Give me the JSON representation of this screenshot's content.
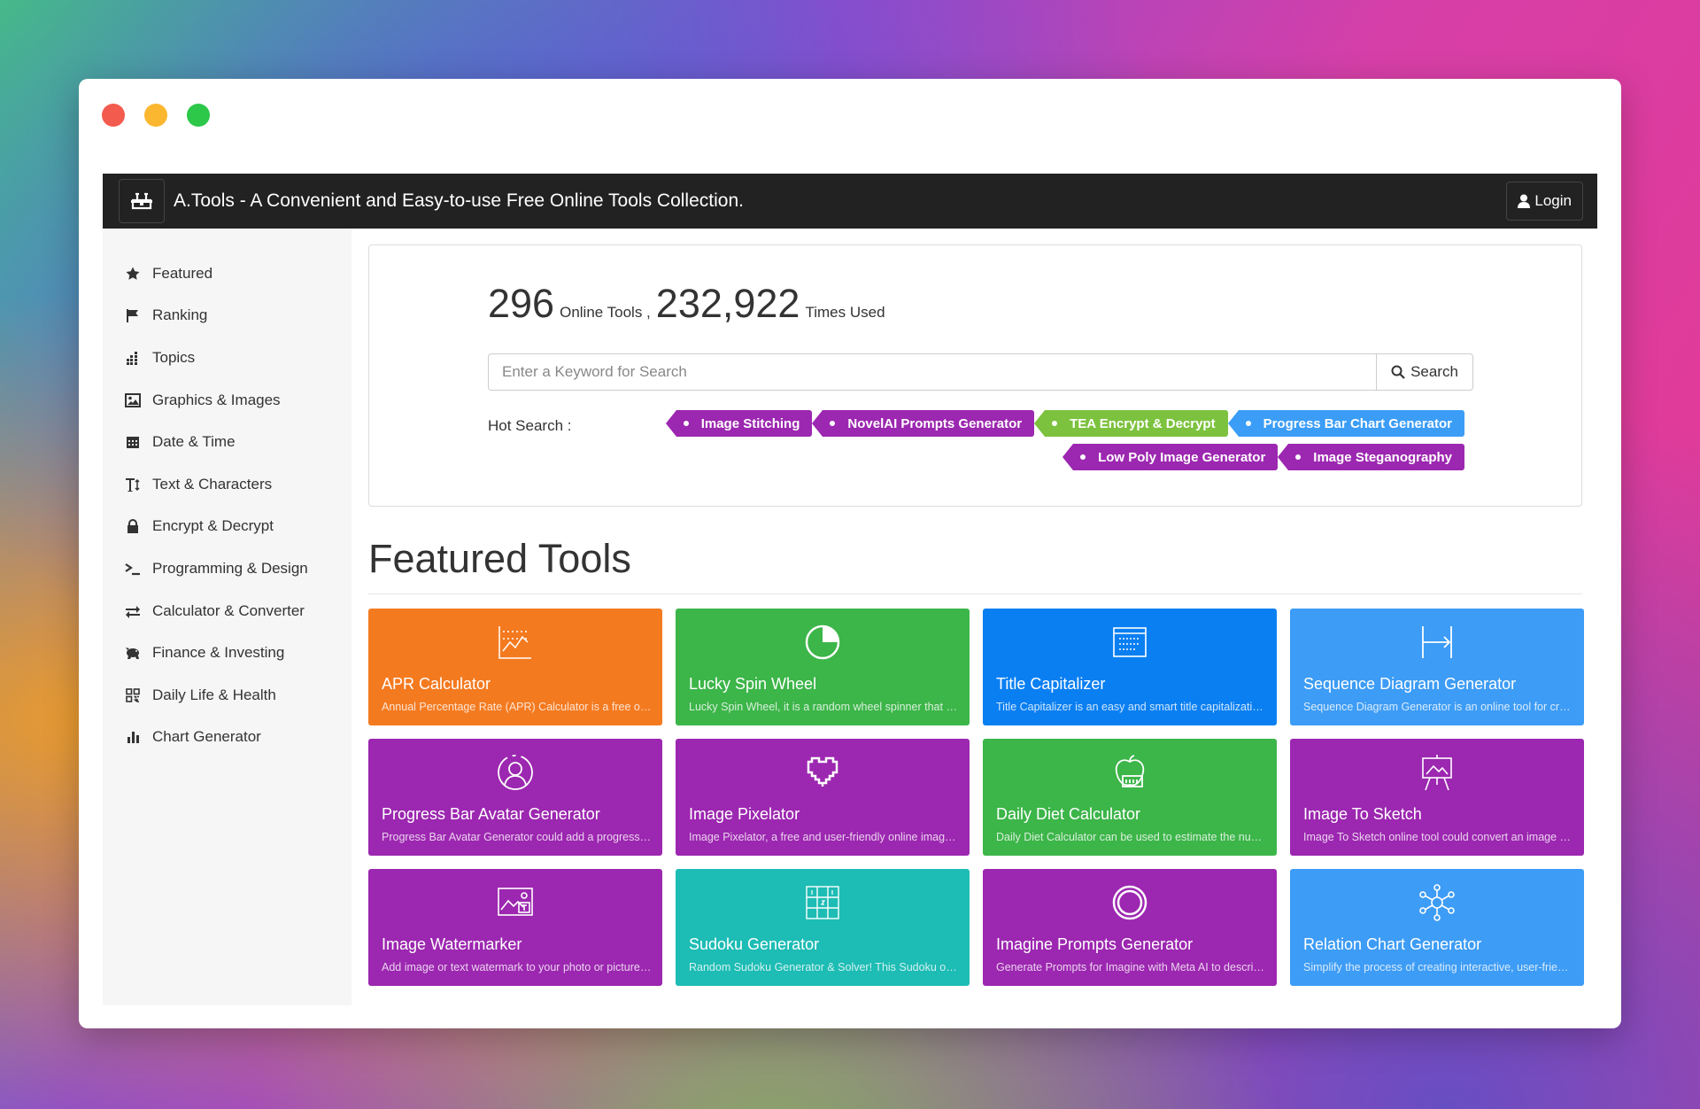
{
  "header": {
    "title": "A.Tools - A Convenient and Easy-to-use Free Online Tools Collection.",
    "login_label": "Login"
  },
  "sidebar": {
    "items": [
      {
        "label": "Featured",
        "icon": "star-icon"
      },
      {
        "label": "Ranking",
        "icon": "flag-icon"
      },
      {
        "label": "Topics",
        "icon": "dots-grid-icon"
      },
      {
        "label": "Graphics & Images",
        "icon": "image-icon"
      },
      {
        "label": "Date & Time",
        "icon": "calendar-icon"
      },
      {
        "label": "Text & Characters",
        "icon": "text-height-icon"
      },
      {
        "label": "Encrypt & Decrypt",
        "icon": "lock-icon"
      },
      {
        "label": "Programming & Design",
        "icon": "terminal-icon"
      },
      {
        "label": "Calculator & Converter",
        "icon": "swap-arrows-icon"
      },
      {
        "label": "Finance & Investing",
        "icon": "piggy-bank-icon"
      },
      {
        "label": "Daily Life & Health",
        "icon": "qr-code-icon"
      },
      {
        "label": "Chart Generator",
        "icon": "bar-chart-icon"
      }
    ]
  },
  "hero": {
    "tools_count": "296",
    "tools_label": "Online Tools ,",
    "uses_count": "232,922",
    "uses_label": "Times Used",
    "search_placeholder": "Enter a Keyword for Search",
    "search_label": "Search",
    "hot_label": "Hot Search :",
    "hot_tags": [
      {
        "label": "Image Stitching",
        "color": "#9c27b0"
      },
      {
        "label": "NovelAI Prompts Generator",
        "color": "#9c27b0"
      },
      {
        "label": "TEA Encrypt & Decrypt",
        "color": "#7cc23f"
      },
      {
        "label": "Progress Bar Chart Generator",
        "color": "#3b9df6"
      },
      {
        "label": "Low Poly Image Generator",
        "color": "#9c27b0"
      },
      {
        "label": "Image Steganography",
        "color": "#9c27b0"
      }
    ]
  },
  "featured": {
    "title": "Featured Tools",
    "cards": [
      {
        "title": "APR Calculator",
        "desc": "Annual Percentage Rate (APR) Calculator is a free online tool to calculate APR",
        "color": "#f47a20",
        "icon": "line-chart-icon"
      },
      {
        "title": "Lucky Spin Wheel",
        "desc": "Lucky Spin Wheel, it is a random wheel spinner that helps you decide",
        "color": "#3cb549",
        "icon": "pie-chart-icon"
      },
      {
        "title": "Title Capitalizer",
        "desc": "Title Capitalizer is an easy and smart title capitalization tool",
        "color": "#0a7ff2",
        "icon": "document-lines-icon"
      },
      {
        "title": "Sequence Diagram Generator",
        "desc": "Sequence Diagram Generator is an online tool for creating diagrams",
        "color": "#3d9cf5",
        "icon": "sequence-arrow-icon"
      },
      {
        "title": "Progress Bar Avatar Generator",
        "desc": "Progress Bar Avatar Generator could add a progress bar to your avatar",
        "color": "#9c27b0",
        "icon": "avatar-circle-icon"
      },
      {
        "title": "Image Pixelator",
        "desc": "Image Pixelator, a free and user-friendly online image pixelation tool",
        "color": "#9c27b0",
        "icon": "pixel-heart-icon"
      },
      {
        "title": "Daily Diet Calculator",
        "desc": "Daily Diet Calculator can be used to estimate the number of calories",
        "color": "#3cb549",
        "icon": "apple-scale-icon"
      },
      {
        "title": "Image To Sketch",
        "desc": "Image To Sketch online tool could convert an image to a sketch",
        "color": "#9c27b0",
        "icon": "easel-icon"
      },
      {
        "title": "Image Watermarker",
        "desc": "Add image or text watermark to your photo or picture online",
        "color": "#9c27b0",
        "icon": "image-text-icon"
      },
      {
        "title": "Sudoku Generator",
        "desc": "Random Sudoku Generator & Solver! This Sudoku online tool",
        "color": "#1dbcb4",
        "icon": "sudoku-grid-icon"
      },
      {
        "title": "Imagine Prompts Generator",
        "desc": "Generate Prompts for Imagine with Meta AI to describe images",
        "color": "#9c27b0",
        "icon": "ring-icon"
      },
      {
        "title": "Relation Chart Generator",
        "desc": "Simplify the process of creating interactive, user-friendly charts",
        "color": "#3d9cf5",
        "icon": "network-nodes-icon"
      }
    ]
  }
}
